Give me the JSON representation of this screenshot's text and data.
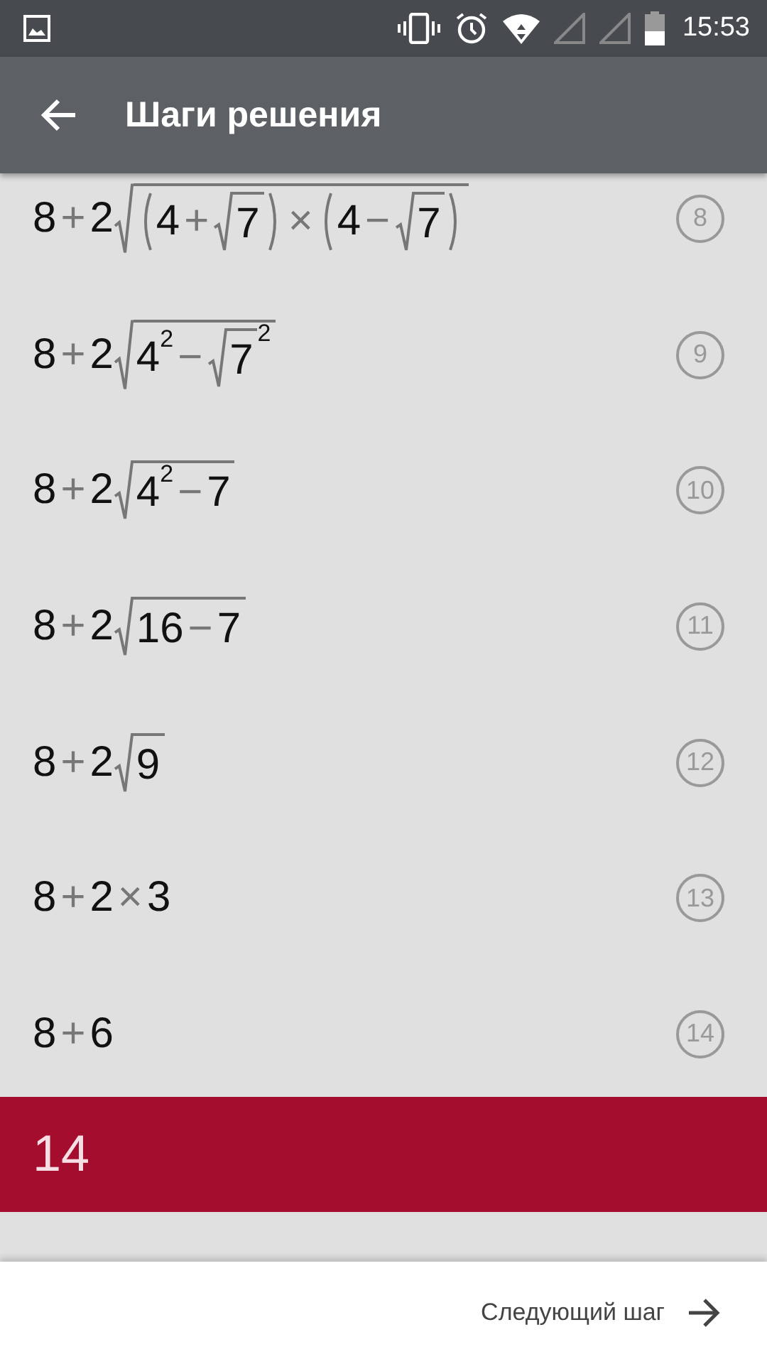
{
  "status_bar": {
    "time": "15:53"
  },
  "app_bar": {
    "title": "Шаги решения"
  },
  "steps": [
    {
      "number": "8",
      "expr": [
        {
          "kind": "num",
          "text": "8"
        },
        {
          "kind": "op",
          "text": "+"
        },
        {
          "kind": "num",
          "text": "2"
        },
        {
          "kind": "sqrt",
          "children": [
            {
              "kind": "paren",
              "children": [
                {
                  "kind": "num",
                  "text": "4"
                },
                {
                  "kind": "op",
                  "text": "+"
                },
                {
                  "kind": "sqrt",
                  "children": [
                    {
                      "kind": "num",
                      "text": "7"
                    }
                  ]
                }
              ]
            },
            {
              "kind": "op",
              "text": "×"
            },
            {
              "kind": "paren",
              "children": [
                {
                  "kind": "num",
                  "text": "4"
                },
                {
                  "kind": "op",
                  "text": "−"
                },
                {
                  "kind": "sqrt",
                  "children": [
                    {
                      "kind": "num",
                      "text": "7"
                    }
                  ]
                }
              ]
            }
          ]
        }
      ]
    },
    {
      "number": "9",
      "expr": [
        {
          "kind": "num",
          "text": "8"
        },
        {
          "kind": "op",
          "text": "+"
        },
        {
          "kind": "num",
          "text": "2"
        },
        {
          "kind": "sqrt",
          "children": [
            {
              "kind": "sup",
              "exp": "2",
              "children": [
                {
                  "kind": "num",
                  "text": "4"
                }
              ]
            },
            {
              "kind": "op",
              "text": "−"
            },
            {
              "kind": "sup",
              "exp": "2",
              "children": [
                {
                  "kind": "sqrt",
                  "children": [
                    {
                      "kind": "num",
                      "text": "7"
                    }
                  ]
                }
              ]
            }
          ]
        }
      ]
    },
    {
      "number": "10",
      "expr": [
        {
          "kind": "num",
          "text": "8"
        },
        {
          "kind": "op",
          "text": "+"
        },
        {
          "kind": "num",
          "text": "2"
        },
        {
          "kind": "sqrt",
          "children": [
            {
              "kind": "sup",
              "exp": "2",
              "children": [
                {
                  "kind": "num",
                  "text": "4"
                }
              ]
            },
            {
              "kind": "op",
              "text": "−"
            },
            {
              "kind": "num",
              "text": "7"
            }
          ]
        }
      ]
    },
    {
      "number": "11",
      "expr": [
        {
          "kind": "num",
          "text": "8"
        },
        {
          "kind": "op",
          "text": "+"
        },
        {
          "kind": "num",
          "text": "2"
        },
        {
          "kind": "sqrt",
          "children": [
            {
              "kind": "num",
              "text": "16"
            },
            {
              "kind": "op",
              "text": "−"
            },
            {
              "kind": "num",
              "text": "7"
            }
          ]
        }
      ]
    },
    {
      "number": "12",
      "expr": [
        {
          "kind": "num",
          "text": "8"
        },
        {
          "kind": "op",
          "text": "+"
        },
        {
          "kind": "num",
          "text": "2"
        },
        {
          "kind": "sqrt",
          "children": [
            {
              "kind": "num",
              "text": "9"
            }
          ]
        }
      ]
    },
    {
      "number": "13",
      "expr": [
        {
          "kind": "num",
          "text": "8"
        },
        {
          "kind": "op",
          "text": "+"
        },
        {
          "kind": "num",
          "text": "2"
        },
        {
          "kind": "op",
          "text": "×"
        },
        {
          "kind": "num",
          "text": "3"
        }
      ]
    },
    {
      "number": "14",
      "expr": [
        {
          "kind": "num",
          "text": "8"
        },
        {
          "kind": "op",
          "text": "+"
        },
        {
          "kind": "num",
          "text": "6"
        }
      ]
    }
  ],
  "result": {
    "text": "14"
  },
  "next_button": {
    "label": "Следующий шаг"
  }
}
